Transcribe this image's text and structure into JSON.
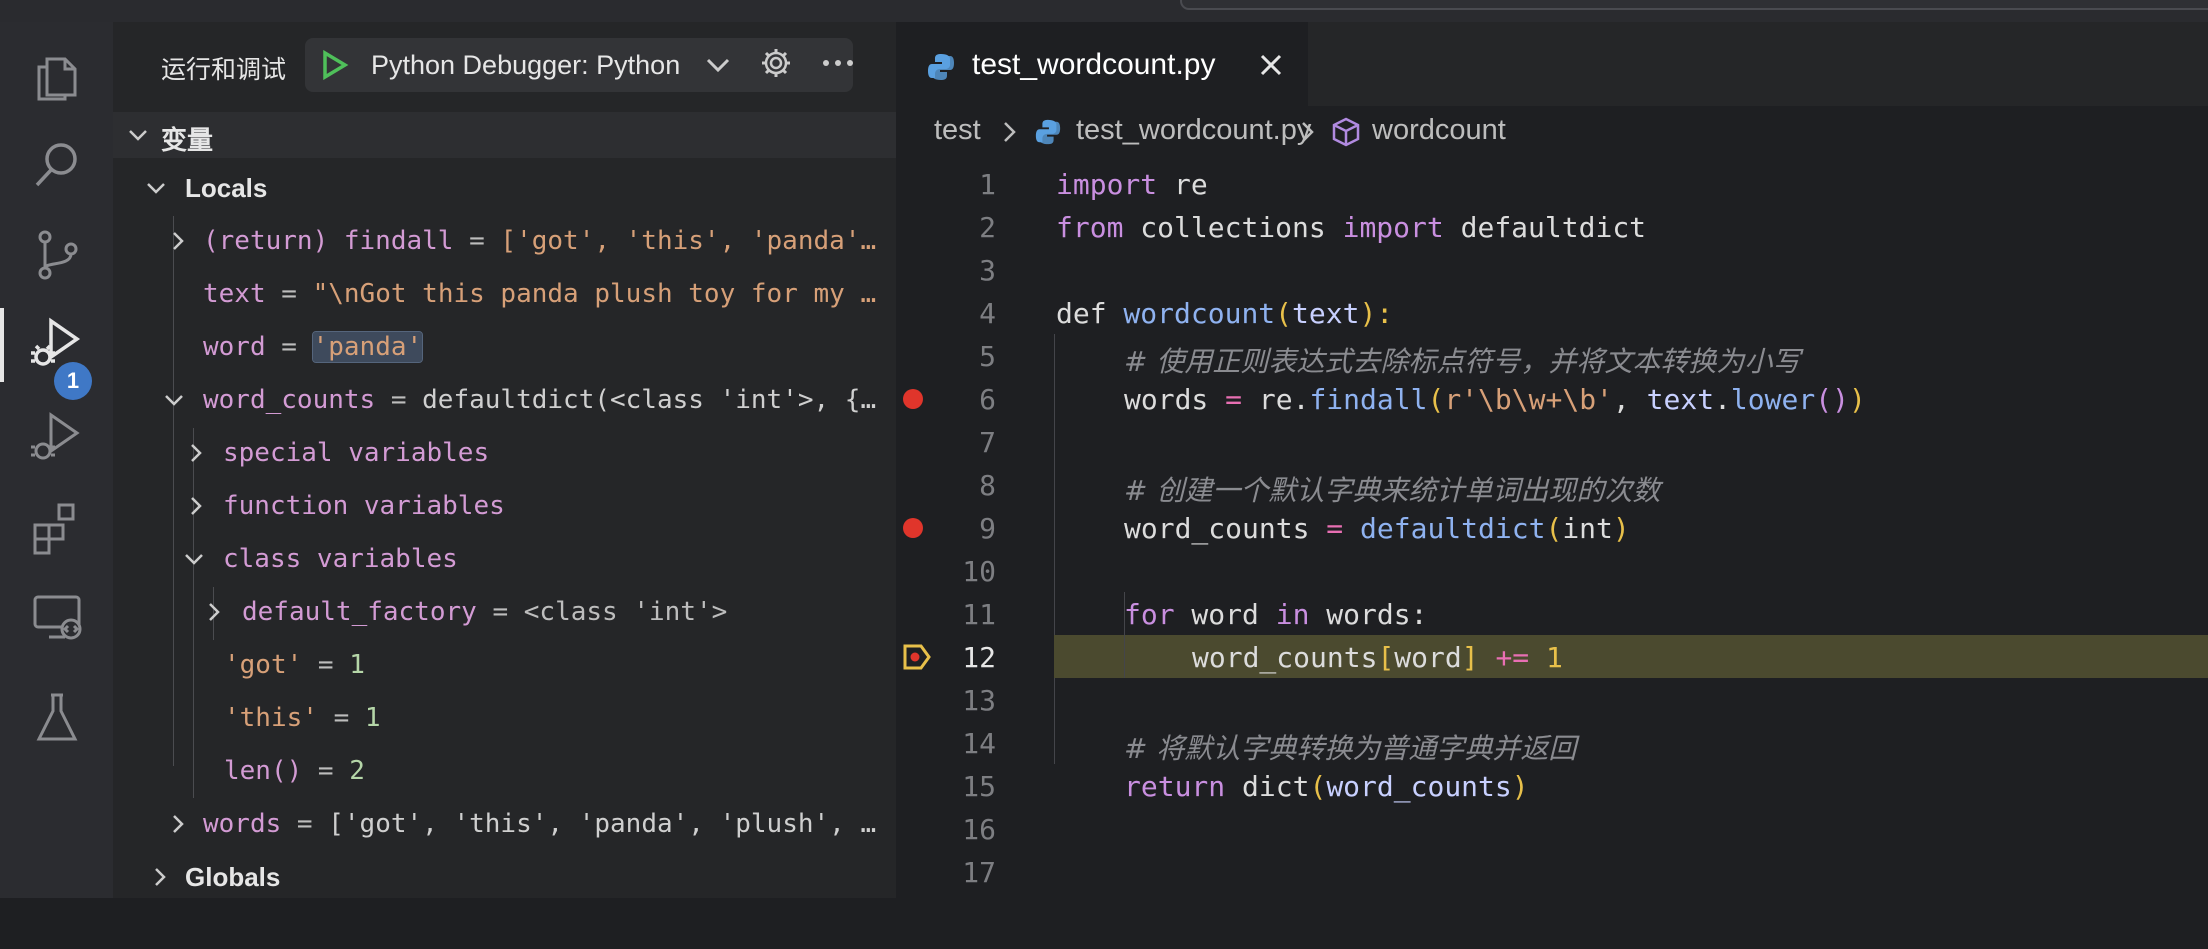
{
  "sidebar": {
    "title": "运行和调试",
    "config_label": "Python Debugger: Python",
    "section": "变量",
    "locals_label": "Locals",
    "globals_label": "Globals",
    "variables": [
      {
        "name": "(return) findall",
        "eq": " = ",
        "value": "['got', 'this', 'panda'…"
      },
      {
        "name": "text",
        "eq": " = ",
        "value": "\"\\nGot this panda plush toy for my …"
      },
      {
        "name": "word",
        "eq": " = ",
        "value": "'panda'"
      },
      {
        "name": "word_counts",
        "eq": " = ",
        "value": "defaultdict(<class 'int'>, {…"
      },
      {
        "name": "special variables"
      },
      {
        "name": "function variables"
      },
      {
        "name": "class variables"
      },
      {
        "name": "default_factory",
        "eq": " = ",
        "value": "<class 'int'>"
      },
      {
        "name": "'got'",
        "eq": " = ",
        "value": "1"
      },
      {
        "name": "'this'",
        "eq": " = ",
        "value": "1"
      },
      {
        "name": "len()",
        "eq": " = ",
        "value": "2"
      },
      {
        "name": "words",
        "eq": " = ",
        "value": "['got', 'this', 'panda', 'plush', …"
      }
    ]
  },
  "activity_badge": "1",
  "editor": {
    "tab_name": "test_wordcount.py",
    "breadcrumb": [
      "test",
      "test_wordcount.py",
      "wordcount"
    ],
    "line_numbers": [
      "1",
      "2",
      "3",
      "4",
      "5",
      "6",
      "7",
      "8",
      "9",
      "10",
      "11",
      "12",
      "13",
      "14",
      "15",
      "16",
      "17"
    ],
    "current_line": "12",
    "breakpoint_lines": [
      "6",
      "9"
    ],
    "code": {
      "l1_a": "import",
      "l1_b": " re",
      "l2_a": "from",
      "l2_b": " collections ",
      "l2_c": "import",
      "l2_d": " defaultdict",
      "l4_a": "def",
      "l4_b": " wordcount",
      "l4_c": "(",
      "l4_d": "text",
      "l4_e": "):",
      "l5": "# 使用正则表达式去除标点符号，并将文本转换为小写",
      "l6_a": "words ",
      "l6_b": "=",
      "l6_c": " re.",
      "l6_d": "findall",
      "l6_e": "(",
      "l6_f": "r'\\b\\w+\\b'",
      "l6_g": ", ",
      "l6_h": "text",
      "l6_i": ".",
      "l6_j": "lower",
      "l6_k": "()",
      "l6_l": ")",
      "l8": "# 创建一个默认字典来统计单词出现的次数",
      "l9_a": "word_counts ",
      "l9_b": "=",
      "l9_c": " defaultdict",
      "l9_d": "(",
      "l9_e": "int",
      "l9_f": ")",
      "l11_a": "for",
      "l11_b": " word ",
      "l11_c": "in",
      "l11_d": " words:",
      "l12_a": "word_counts",
      "l12_b": "[",
      "l12_c": "word",
      "l12_d": "]",
      "l12_e": " += ",
      "l12_f": "1",
      "l14": "# 将默认字典转换为普通字典并返回",
      "l15_a": "return",
      "l15_b": " dict",
      "l15_c": "(",
      "l15_d": "word_counts",
      "l15_e": ")"
    }
  },
  "colors": {
    "accent": "#3f78c6",
    "breakpoint": "#e0352b",
    "current_line": "#4b4a2f"
  }
}
